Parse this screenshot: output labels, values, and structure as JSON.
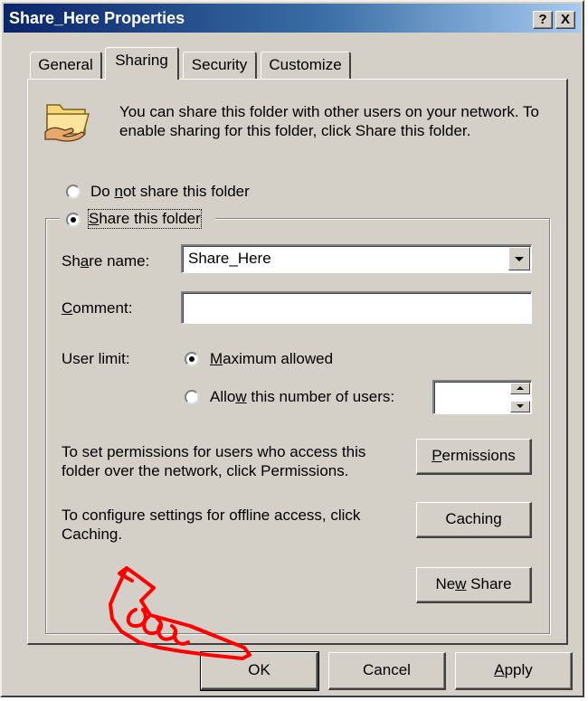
{
  "window": {
    "title": "Share_Here Properties",
    "help_button": "?",
    "close_button": "X"
  },
  "tabs": [
    {
      "label": "General",
      "active": false
    },
    {
      "label": "Sharing",
      "active": true
    },
    {
      "label": "Security",
      "active": false
    },
    {
      "label": "Customize",
      "active": false
    }
  ],
  "sharing": {
    "folder_icon": "shared-folder-icon",
    "intro_text": "You can share this folder with other users on your network.  To enable sharing for this folder, click Share this folder.",
    "do_not_share": {
      "pre": "Do ",
      "u": "n",
      "post": "ot share this folder",
      "selected": false
    },
    "share_this": {
      "pre": "",
      "u": "S",
      "post": "hare this folder",
      "selected": true
    },
    "share_name": {
      "label_pre": "Sh",
      "label_u": "a",
      "label_post": "re name:",
      "value": "Share_Here"
    },
    "comment": {
      "label_pre": "",
      "label_u": "C",
      "label_post": "omment:",
      "value": ""
    },
    "user_limit": {
      "label": "User limit:",
      "maximum": {
        "pre": "",
        "u": "M",
        "post": "aximum allowed",
        "selected": true
      },
      "allow": {
        "pre": "Allo",
        "u": "w",
        "post": " this number of users:",
        "selected": false
      },
      "count_value": ""
    },
    "permissions_text": "To set permissions for users who access this folder over the network, click Permissions.",
    "permissions_button": {
      "pre": "",
      "u": "P",
      "post": "ermissions"
    },
    "caching_text": "To configure settings for offline access, click Caching.",
    "caching_button": {
      "pre": "Caching",
      "u": "",
      "post": ""
    },
    "new_share_button": {
      "pre": "Ne",
      "u": "w",
      "post": " Share"
    }
  },
  "footer": {
    "ok_label": "OK",
    "cancel_label": "Cancel",
    "apply_button": {
      "pre": "",
      "u": "A",
      "post": "pply"
    }
  },
  "annotation": {
    "icon": "pointing-hand-icon",
    "color": "#ff0000"
  },
  "colors": {
    "face": "#d4d0c8",
    "title_start": "#0a246a",
    "title_end": "#a6caf0"
  }
}
